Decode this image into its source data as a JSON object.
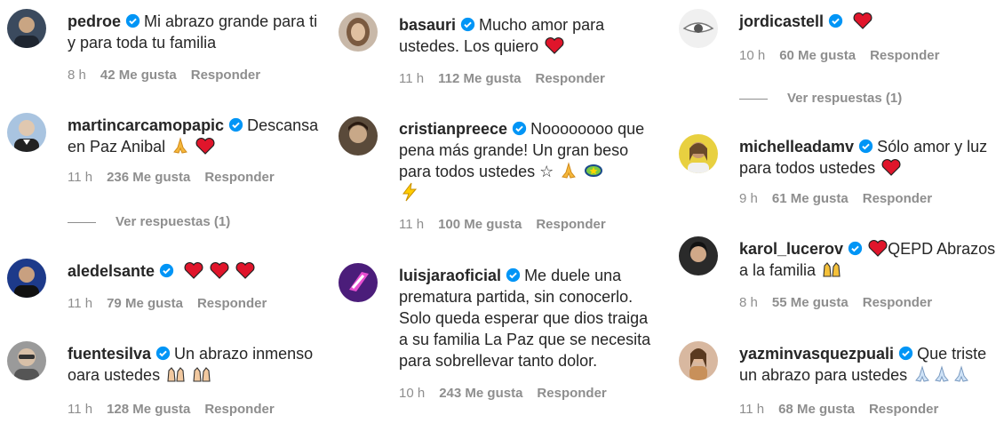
{
  "columns": [
    [
      {
        "user": "pedroe",
        "text": "Mi abrazo grande para ti y para toda tu familia",
        "emojis": [],
        "time": "8 h",
        "likes": "42 Me gusta",
        "reply": "Responder",
        "replies": null,
        "avatar": {
          "bg": "#3b4a5e",
          "fg": "#c9b08a"
        }
      },
      {
        "user": "martincarcamopapic",
        "text": "Descansa en Paz Anibal",
        "emojis": [
          "pray-icon",
          "heart-icon"
        ],
        "time": "11 h",
        "likes": "236 Me gusta",
        "reply": "Responder",
        "replies": "Ver respuestas (1)",
        "avatar": {
          "bg": "#a9c4e0",
          "fg": "#e0c8b0"
        }
      },
      {
        "user": "aledelsante",
        "text": "",
        "emojis": [
          "heart-icon",
          "heart-icon",
          "heart-icon"
        ],
        "time": "11 h",
        "likes": "79 Me gusta",
        "reply": "Responder",
        "replies": null,
        "avatar": {
          "bg": "#1d3a8a",
          "fg": "#c8a080"
        }
      },
      {
        "user": "fuentesilva",
        "text": "Un abrazo inmenso oara ustedes",
        "emojis": [
          "raised-hands-icon",
          "raised-hands-icon"
        ],
        "time": "11 h",
        "likes": "128 Me gusta",
        "reply": "Responder",
        "replies": null,
        "avatar": {
          "bg": "#9a9a9a",
          "fg": "#d8c0a8"
        }
      }
    ],
    [
      {
        "user": "basauri",
        "text": "Mucho amor para ustedes. Los quiero",
        "emojis": [
          "heart-icon"
        ],
        "time": "11 h",
        "likes": "112 Me gusta",
        "reply": "Responder",
        "replies": null,
        "avatar": {
          "bg": "#c8b8a8",
          "fg": "#7a5a40"
        }
      },
      {
        "user": "cristianpreece",
        "text": "Noooooooo que pena más grande! Un gran beso para todos ustedes ☆",
        "emojis": [
          "pray-icon",
          "dizzy-icon",
          "lightning-icon"
        ],
        "time": "11 h",
        "likes": "100 Me gusta",
        "reply": "Responder",
        "replies": null,
        "avatar": {
          "bg": "#5a4a3a",
          "fg": "#c8a888"
        }
      },
      {
        "user": "luisjaraoficial",
        "text": "Me duele una prematura partida, sin conocerlo. Solo queda esperar que dios traiga a su familia La Paz que se necesita para sobrellevar tanto dolor.",
        "emojis": [],
        "time": "10 h",
        "likes": "243 Me gusta",
        "reply": "Responder",
        "replies": null,
        "avatar": {
          "bg": "#4b1d7a",
          "fg": "#e84fd0"
        }
      }
    ],
    [
      {
        "user": "jordicastell",
        "text": "",
        "emojis": [
          "heart-icon"
        ],
        "time": "10 h",
        "likes": "60 Me gusta",
        "reply": "Responder",
        "replies": "Ver respuestas (1)",
        "avatar": {
          "bg": "#f0f0f0",
          "fg": "#555555"
        }
      },
      {
        "user": "michelleadamv",
        "text": "Sólo amor y luz para todos ustedes",
        "emojis": [
          "heart-icon"
        ],
        "time": "9 h",
        "likes": "61 Me gusta",
        "reply": "Responder",
        "replies": null,
        "avatar": {
          "bg": "#e8d040",
          "fg": "#c89870"
        }
      },
      {
        "user": "karol_lucerov",
        "text": "QEPD Abrazos a la familia",
        "emojis": [
          "raised-hands-icon"
        ],
        "time": "8 h",
        "likes": "55 Me gusta",
        "reply": "Responder",
        "replies": null,
        "avatar": {
          "bg": "#2a2a2a",
          "fg": "#d0a888"
        }
      },
      {
        "user": "yazminvasquezpuali",
        "text": "Que triste un abrazo para ustedes",
        "emojis": [
          "pray-icon",
          "pray-icon",
          "pray-icon"
        ],
        "time": "11 h",
        "likes": "68 Me gusta",
        "reply": "Responder",
        "replies": null,
        "avatar": {
          "bg": "#d8b8a0",
          "fg": "#8a5a40"
        }
      }
    ]
  ]
}
